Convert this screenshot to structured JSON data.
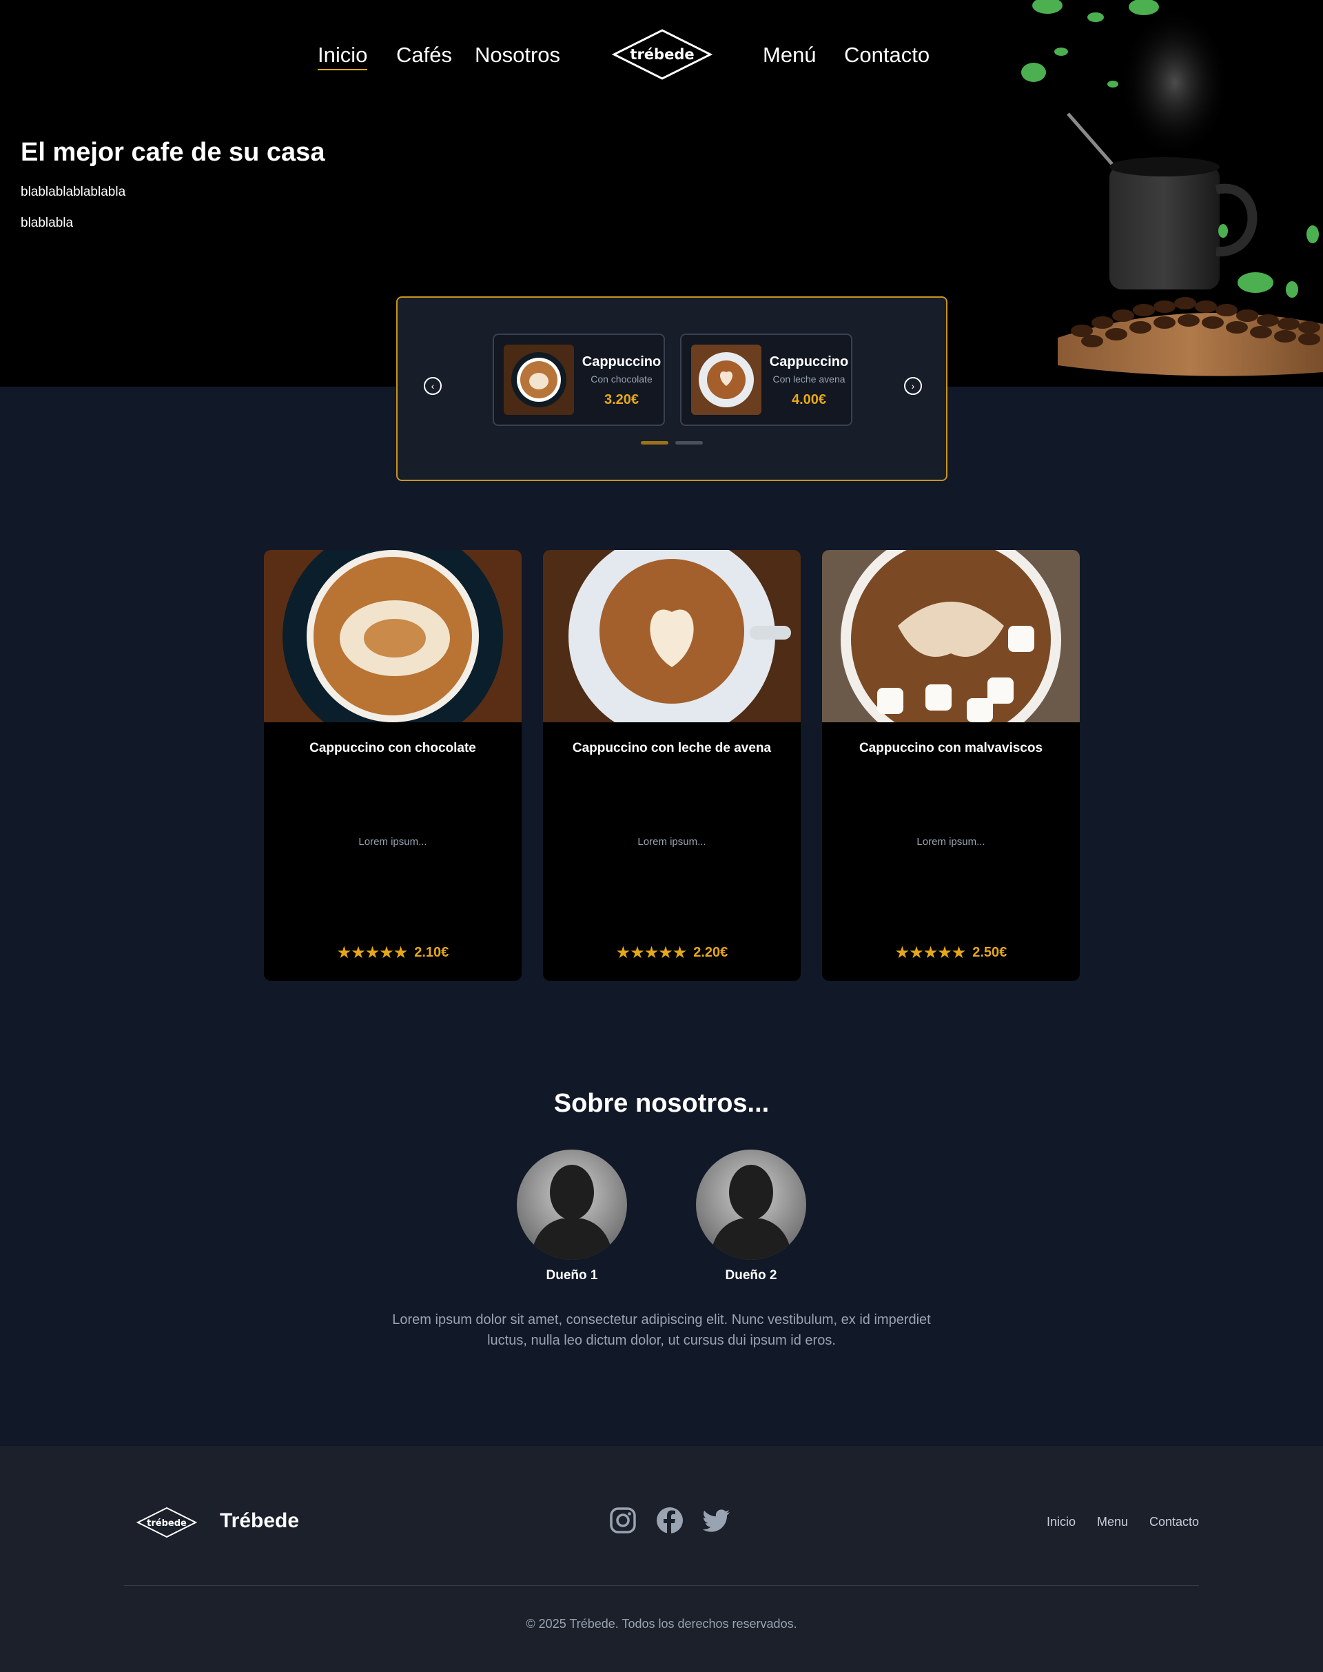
{
  "nav": {
    "items": [
      "Inicio",
      "Cafés",
      "Nosotros",
      "Menú",
      "Contacto"
    ],
    "logo_text": "trébede",
    "active": "Inicio"
  },
  "hero": {
    "title": "El mejor cafe de su casa",
    "line1": "blablablablablabla",
    "line2": "blablabla"
  },
  "carousel": {
    "prev_icon": "chevron-left-icon",
    "next_icon": "chevron-right-icon",
    "items": [
      {
        "title": "Cappuccino",
        "subtitle": "Con chocolate",
        "price": "3.20€"
      },
      {
        "title": "Cappuccino",
        "subtitle": "Con leche avena",
        "price": "4.00€"
      }
    ],
    "active_index": 0
  },
  "products": [
    {
      "title": "Cappuccino con chocolate",
      "desc": "Lorem ipsum...",
      "rating": 5,
      "price": "2.10€"
    },
    {
      "title": "Cappuccino con leche de avena",
      "desc": "Lorem ipsum...",
      "rating": 5,
      "price": "2.20€"
    },
    {
      "title": "Cappuccino con malvaviscos",
      "desc": "Lorem ipsum...",
      "rating": 5,
      "price": "2.50€"
    }
  ],
  "about": {
    "title": "Sobre nosotros...",
    "owners": [
      "Dueño 1",
      "Dueño 2"
    ],
    "text": "Lorem ipsum dolor sit amet, consectetur adipiscing elit. Nunc vestibulum, ex id imperdiet luctus, nulla leo dictum dolor, ut cursus dui ipsum id eros."
  },
  "footer": {
    "logo_text": "trébede",
    "brand": "Trébede",
    "social": [
      "instagram-icon",
      "facebook-icon",
      "twitter-icon"
    ],
    "links": [
      "Inicio",
      "Menu",
      "Contacto"
    ],
    "copyright": "© 2025 Trébede. Todos los derechos reservados."
  },
  "colors": {
    "accent": "#e6a817",
    "hero_bg": "#000000",
    "page_bg": "#111827",
    "footer_bg": "#1b202b"
  }
}
